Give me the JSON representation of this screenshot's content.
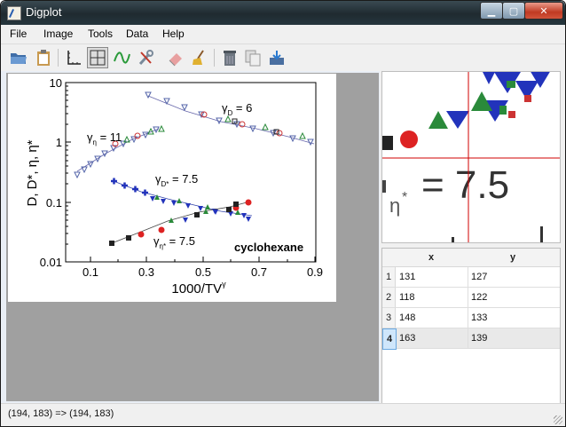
{
  "window": {
    "title": "Digplot"
  },
  "menu": [
    {
      "label": "File"
    },
    {
      "label": "Image"
    },
    {
      "label": "Tools"
    },
    {
      "label": "Data"
    },
    {
      "label": "Help"
    }
  ],
  "toolbar": {
    "tools": [
      "open-folder-icon",
      "clipboard-icon",
      "axes-icon",
      "crosshair-icon",
      "curve-icon",
      "wrench-icon",
      "eraser-icon",
      "broom-icon",
      "trash-icon",
      "copy-icon",
      "export-icon"
    ],
    "active": "crosshair-icon"
  },
  "figure": {
    "ylabel": "D, D*, η, η*",
    "xlabel": "1000/TV",
    "xlabel_sup": "γ",
    "xticks": [
      "0.1",
      "0.3",
      "0.5",
      "0.7",
      "0.9"
    ],
    "yticks": [
      "10",
      "1",
      "0.1",
      "0.01"
    ],
    "annotations": {
      "gamma_eta": "γ",
      "gamma_eta_sub": "η",
      "gamma_eta_val": " = 11",
      "gamma_D": "γ",
      "gamma_D_sub": "D",
      "gamma_D_val": " = 6",
      "gamma_Dstar": "γ",
      "gamma_Dstar_sub": "D*",
      "gamma_Dstar_val": " = 7.5",
      "gamma_etastar": "γ",
      "gamma_etastar_sub": "η*",
      "gamma_etastar_val": " = 7.5",
      "compound": "cyclohexane"
    }
  },
  "zoom": {
    "text": "= 7.5",
    "sub": "η",
    "sup": "*"
  },
  "table": {
    "headers": {
      "x": "x",
      "y": "y"
    },
    "rows": [
      {
        "idx": "1",
        "x": "131",
        "y": "127"
      },
      {
        "idx": "2",
        "x": "118",
        "y": "122"
      },
      {
        "idx": "3",
        "x": "148",
        "y": "133"
      },
      {
        "idx": "4",
        "x": "163",
        "y": "139"
      }
    ],
    "selected_index": "4"
  },
  "status": {
    "text": "(194, 183) => (194, 183)"
  }
}
